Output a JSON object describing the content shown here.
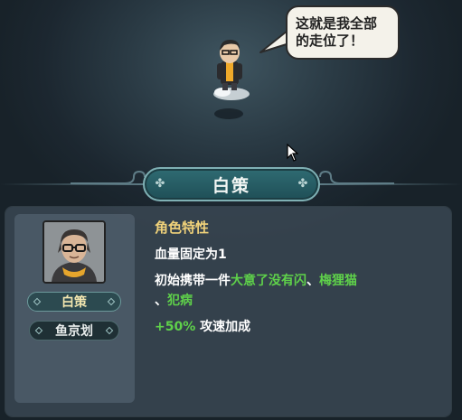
{
  "dialogue": {
    "text_line1": "这就是我全部",
    "text_line2": "的走位了！"
  },
  "character": {
    "name": "白策",
    "author": "鱼京划"
  },
  "traits": {
    "heading": "角色特性",
    "hp_fixed": "血量固定为1",
    "carry_prefix": "初始携带一件",
    "item1": "大意了没有闪",
    "sep1": "、",
    "item2": "梅狸猫",
    "sep2": "、",
    "item3": "犯病",
    "bonus_value": "+50%",
    "bonus_label": " 攻速加成"
  },
  "colors": {
    "heading": "#f0d27a",
    "highlight_green": "#5fd24a",
    "name_gold": "#f3e7b0"
  },
  "icons": {
    "plate_ornament": "clover-icon",
    "cursor": "arrow-cursor-icon"
  }
}
